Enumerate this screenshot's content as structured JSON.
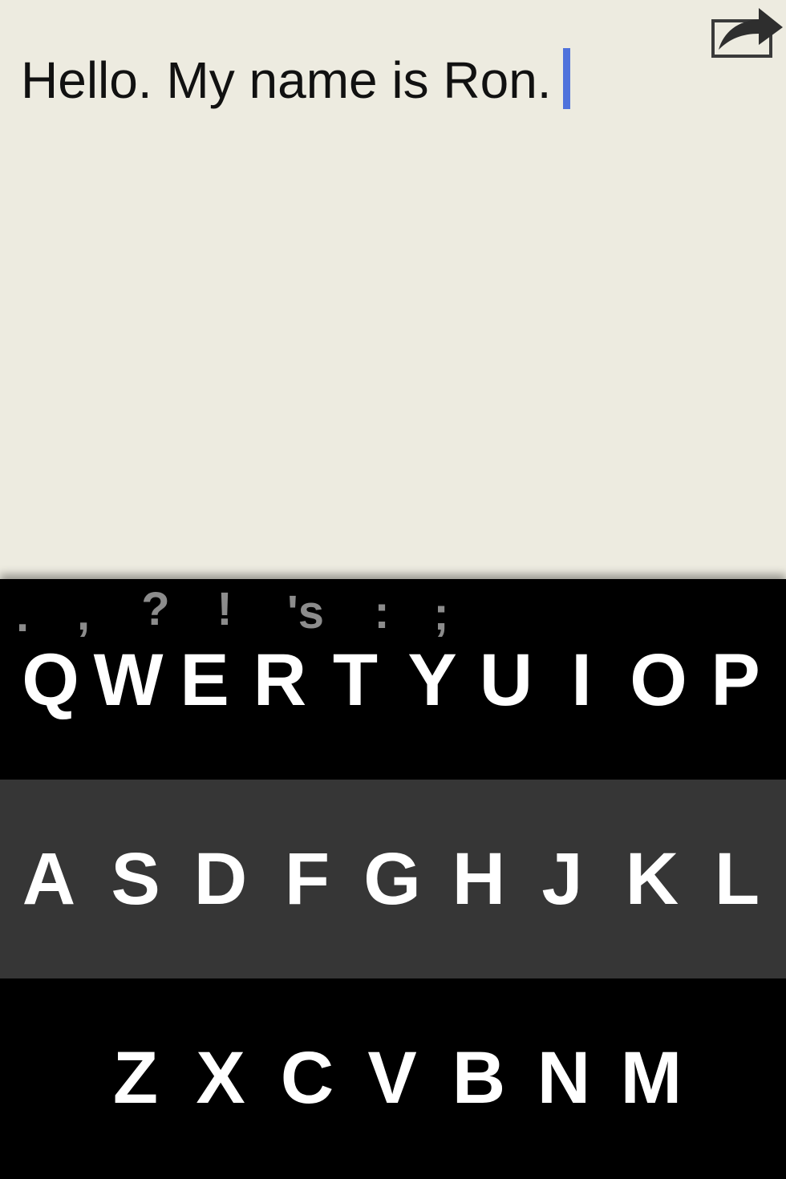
{
  "editor": {
    "text": "Hello. My name is Ron."
  },
  "toolbar": {
    "share_icon": "share-icon"
  },
  "keyboard": {
    "suggestions": [
      ".",
      ",",
      "?",
      "!",
      "'s",
      ":",
      ";"
    ],
    "row1": [
      "Q",
      "W",
      "E",
      "R",
      "T",
      "Y",
      "U",
      "I",
      "O",
      "P"
    ],
    "row2": [
      "A",
      "S",
      "D",
      "F",
      "G",
      "H",
      "J",
      "K",
      "L"
    ],
    "row3": [
      "Z",
      "X",
      "C",
      "V",
      "B",
      "N",
      "M"
    ]
  },
  "colors": {
    "editor_background": "#edebe0",
    "caret": "#4f72dc",
    "keyboard_dark": "#000000",
    "keyboard_middle_row": "#363636",
    "key_text": "#ffffff",
    "suggestion_text": "#8c8c8c"
  }
}
